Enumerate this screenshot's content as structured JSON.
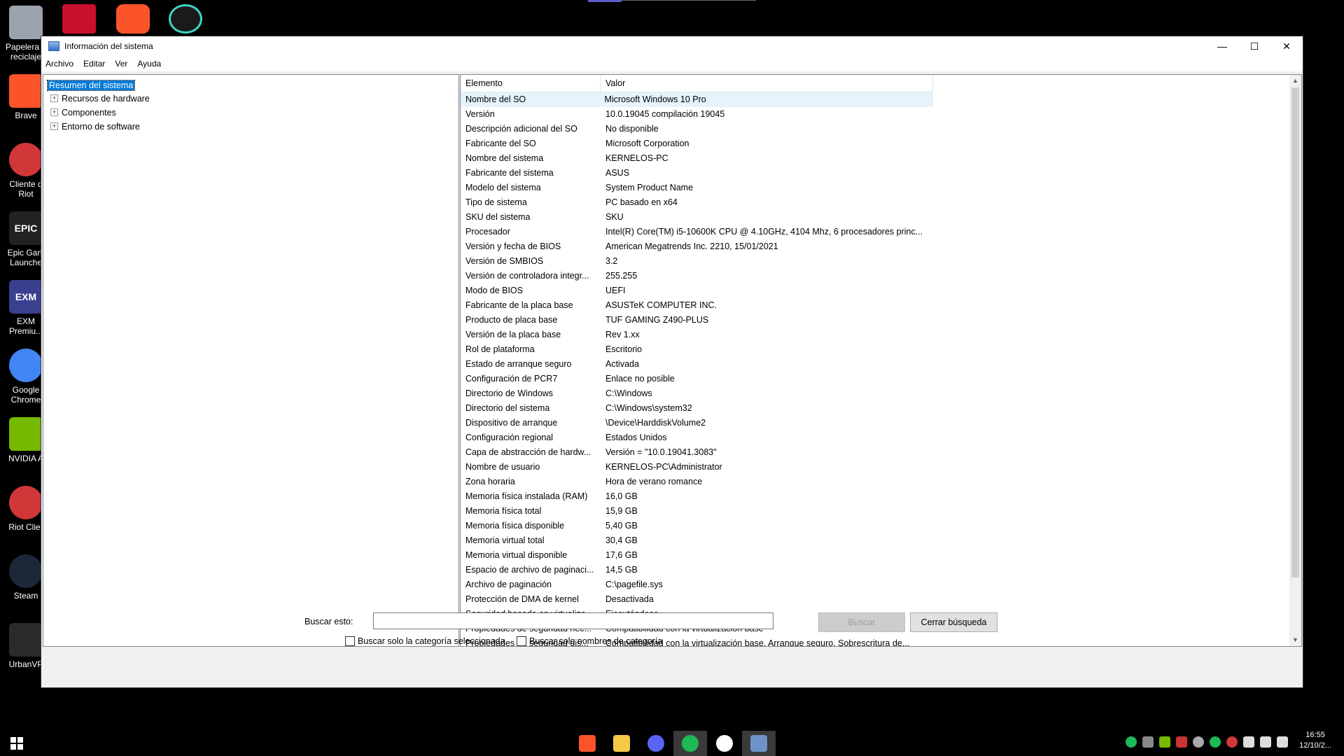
{
  "desktop": {
    "icons": [
      {
        "label": "Papelera d\nreciclaje",
        "name": "recycle-bin-icon",
        "color": "#9aa3ad"
      },
      {
        "label": "Brave",
        "name": "brave-icon",
        "color": "#fb542b"
      },
      {
        "label": "Cliente d\nRiot",
        "name": "riot-client-icon",
        "color": "#d13639"
      },
      {
        "label": "Epic Gam\nLaunche",
        "name": "epic-games-icon",
        "color": "#222222"
      },
      {
        "label": "EXM\nPremiu...",
        "name": "exm-icon",
        "color": "#3b3f8f"
      },
      {
        "label": "Google\nChrome",
        "name": "chrome-icon",
        "color": "#4285f4"
      },
      {
        "label": "NVIDIA A",
        "name": "nvidia-icon",
        "color": "#76b900"
      },
      {
        "label": "Riot Clier",
        "name": "riot-client-2-icon",
        "color": "#d13639"
      },
      {
        "label": "Steam",
        "name": "steam-icon",
        "color": "#1b2838"
      },
      {
        "label": "UrbanVP",
        "name": "urbanvpn-icon",
        "color": "#2a2a2a"
      }
    ],
    "epic_text": "EPIC",
    "exm_text": "EXM"
  },
  "window": {
    "title": "Información del sistema",
    "menu": [
      "Archivo",
      "Editar",
      "Ver",
      "Ayuda"
    ],
    "controls": {
      "minimize": "—",
      "maximize": "☐",
      "close": "✕"
    }
  },
  "tree": {
    "root": "Resumen del sistema",
    "children": [
      "Recursos de hardware",
      "Componentes",
      "Entorno de software"
    ]
  },
  "list": {
    "headers": [
      "Elemento",
      "Valor"
    ],
    "rows": [
      [
        "Nombre del SO",
        "Microsoft Windows 10 Pro"
      ],
      [
        "Versión",
        "10.0.19045 compilación 19045"
      ],
      [
        "Descripción adicional del SO",
        "No disponible"
      ],
      [
        "Fabricante del SO",
        "Microsoft Corporation"
      ],
      [
        "Nombre del sistema",
        "KERNELOS-PC"
      ],
      [
        "Fabricante del sistema",
        "ASUS"
      ],
      [
        "Modelo del sistema",
        "System Product Name"
      ],
      [
        "Tipo de sistema",
        "PC basado en x64"
      ],
      [
        "SKU del sistema",
        "SKU"
      ],
      [
        "Procesador",
        "Intel(R) Core(TM) i5-10600K CPU @ 4.10GHz, 4104 Mhz, 6 procesadores princ..."
      ],
      [
        "Versión y fecha de BIOS",
        "American Megatrends Inc. 2210, 15/01/2021"
      ],
      [
        "Versión de SMBIOS",
        "3.2"
      ],
      [
        "Versión de controladora integr...",
        "255.255"
      ],
      [
        "Modo de BIOS",
        "UEFI"
      ],
      [
        "Fabricante de la placa base",
        "ASUSTeK COMPUTER INC."
      ],
      [
        "Producto de placa base",
        "TUF GAMING Z490-PLUS"
      ],
      [
        "Versión de la placa base",
        "Rev 1.xx"
      ],
      [
        "Rol de plataforma",
        "Escritorio"
      ],
      [
        "Estado de arranque seguro",
        "Activada"
      ],
      [
        "Configuración de PCR7",
        "Enlace no posible"
      ],
      [
        "Directorio de Windows",
        "C:\\Windows"
      ],
      [
        "Directorio del sistema",
        "C:\\Windows\\system32"
      ],
      [
        "Dispositivo de arranque",
        "\\Device\\HarddiskVolume2"
      ],
      [
        "Configuración regional",
        "Estados Unidos"
      ],
      [
        "Capa de abstracción de hardw...",
        "Versión = \"10.0.19041.3083\""
      ],
      [
        "Nombre de usuario",
        "KERNELOS-PC\\Administrator"
      ],
      [
        "Zona horaria",
        "Hora de verano romance"
      ],
      [
        "Memoria física instalada (RAM)",
        "16,0 GB"
      ],
      [
        "Memoria física total",
        "15,9 GB"
      ],
      [
        "Memoria física disponible",
        "5,40 GB"
      ],
      [
        "Memoria virtual total",
        "30,4 GB"
      ],
      [
        "Memoria virtual disponible",
        "17,6 GB"
      ],
      [
        "Espacio de archivo de paginaci...",
        "14,5 GB"
      ],
      [
        "Archivo de paginación",
        "C:\\pagefile.sys"
      ],
      [
        "Protección de DMA de kernel",
        "Desactivada"
      ],
      [
        "Seguridad basada en virtualiza...",
        "Ejecutándose"
      ],
      [
        "Propiedades de seguridad nec...",
        "Compatibilidad con la virtualización base"
      ],
      [
        "Propiedades de seguridad dis...",
        "Compatibilidad con la virtualización base, Arranque seguro, Sobrescritura de..."
      ]
    ]
  },
  "search": {
    "label": "Buscar esto:",
    "value": "",
    "search_button": "Buscar",
    "close_button": "Cerrar búsqueda",
    "check_selected": "Buscar solo la categoría seleccionada",
    "check_names": "Buscar solo nombres de categoría"
  },
  "taskbar": {
    "time": "16:55",
    "date": "12/10/2..."
  }
}
